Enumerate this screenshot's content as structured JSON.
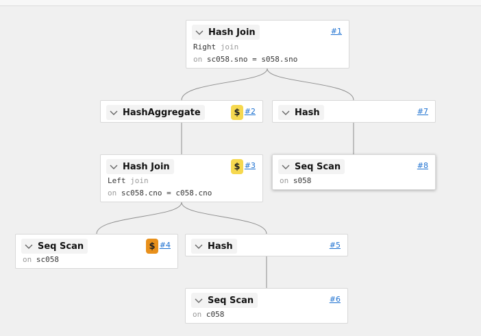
{
  "colors": {
    "cost_light": "#f6d84f",
    "cost_dark": "#e8901b",
    "link": "#1a6fd0",
    "edge": "#8d8d8d"
  },
  "nodes": {
    "n1": {
      "title": "Hash Join",
      "link": "#1",
      "detail": {
        "pre": "Right",
        "kw": "join"
      },
      "cond": {
        "kw": "on",
        "text": "sc058.sno = s058.sno"
      }
    },
    "n2": {
      "title": "HashAggregate",
      "link": "#2",
      "cost": "$"
    },
    "n7": {
      "title": "Hash",
      "link": "#7"
    },
    "n3": {
      "title": "Hash Join",
      "link": "#3",
      "cost": "$",
      "detail": {
        "pre": "Left",
        "kw": "join"
      },
      "cond": {
        "kw": "on",
        "text": "sc058.cno = c058.cno"
      }
    },
    "n8": {
      "title": "Seq Scan",
      "link": "#8",
      "cond": {
        "kw": "on",
        "text": "s058"
      }
    },
    "n4": {
      "title": "Seq Scan",
      "link": "#4",
      "cost": "$",
      "cond": {
        "kw": "on",
        "text": "sc058"
      }
    },
    "n5": {
      "title": "Hash",
      "link": "#5"
    },
    "n6": {
      "title": "Seq Scan",
      "link": "#6",
      "cond": {
        "kw": "on",
        "text": "c058"
      }
    }
  }
}
